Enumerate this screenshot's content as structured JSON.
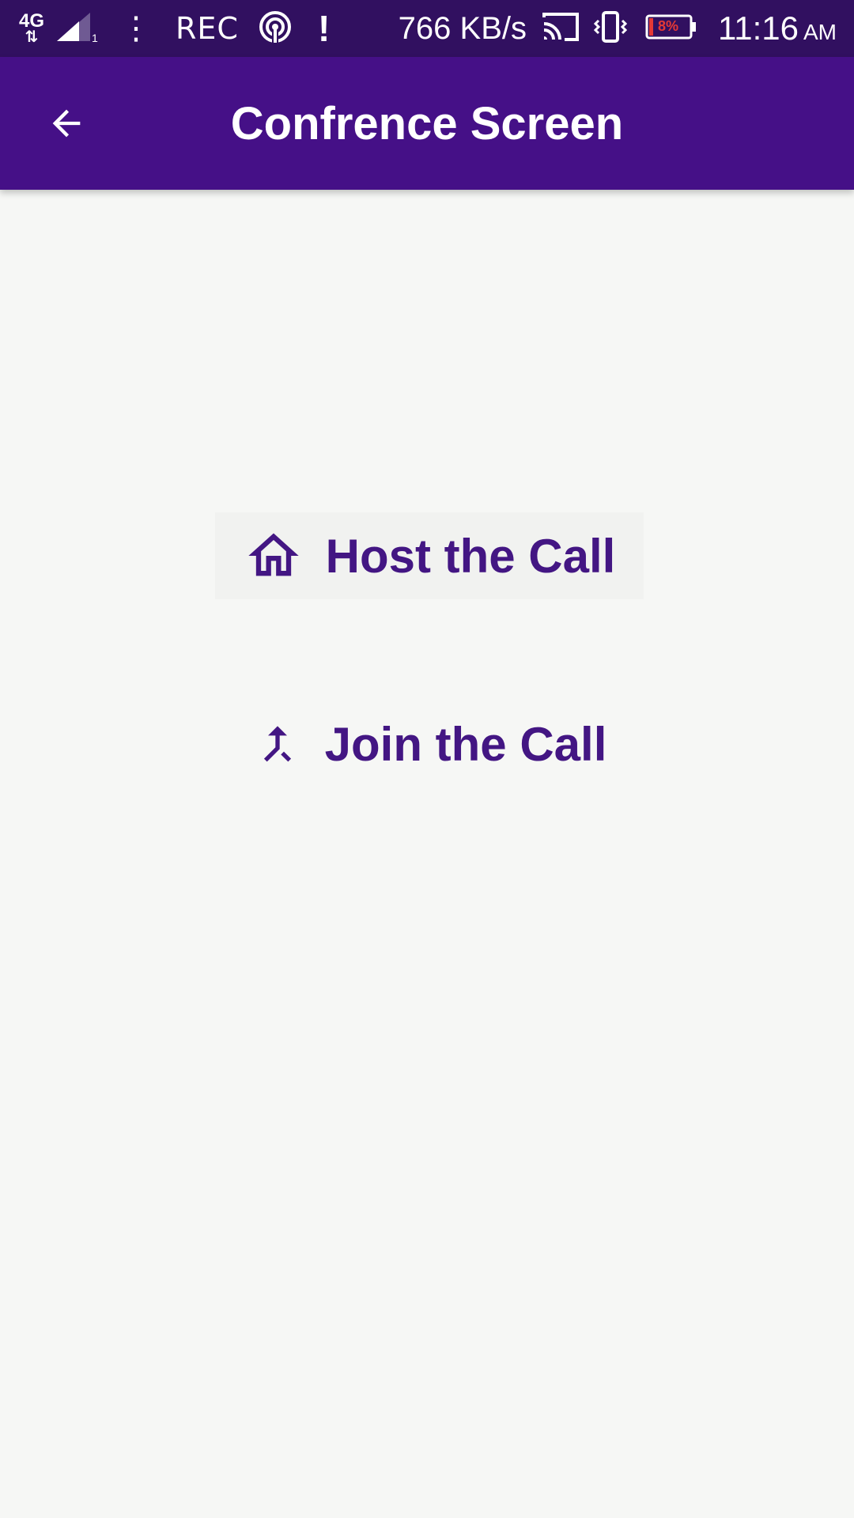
{
  "status_bar": {
    "network_type": "4G",
    "network_arrows": "⇅",
    "sim_slot": "1",
    "more_dots": "⋮",
    "rec_label": "REC",
    "alert_icon": "!",
    "speed": "766 KB/s",
    "battery_level": "8%",
    "time": "11:16",
    "ampm": "AM"
  },
  "app_bar": {
    "title": "Confrence Screen",
    "back_icon": "arrow-back-icon"
  },
  "actions": {
    "host_label": "Host the Call",
    "host_icon": "home-icon",
    "join_label": "Join the Call",
    "join_icon": "merge-icon"
  },
  "colors": {
    "status_bar": "#311060",
    "app_bar": "#451087",
    "accent_text": "#431683",
    "background": "#f6f7f5",
    "battery_low": "#e53935"
  }
}
